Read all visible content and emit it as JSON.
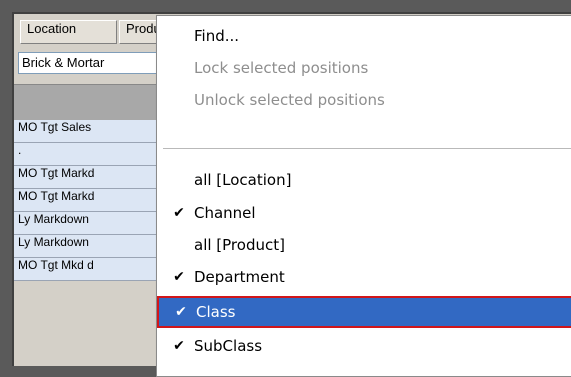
{
  "tabs": [
    {
      "label": "Location"
    },
    {
      "label": "Product"
    }
  ],
  "selector": {
    "value": "Brick & Mortar"
  },
  "rows": [
    {
      "label": "MO Tgt Sales"
    },
    {
      "label": "."
    },
    {
      "label": "MO Tgt Markd"
    },
    {
      "label": "MO Tgt Markd"
    },
    {
      "label": "Ly Markdown"
    },
    {
      "label": "Ly Markdown"
    },
    {
      "label": "MO Tgt Mkd d"
    }
  ],
  "menu": {
    "items": [
      {
        "label": "Find...",
        "disabled": false,
        "checked": false
      },
      {
        "label": "Lock selected positions",
        "disabled": true,
        "checked": false
      },
      {
        "label": "Unlock selected positions",
        "disabled": true,
        "checked": false
      },
      {
        "label": "all [Location]",
        "disabled": false,
        "checked": false
      },
      {
        "label": "Channel",
        "disabled": false,
        "checked": true
      },
      {
        "label": "all [Product]",
        "disabled": false,
        "checked": false
      },
      {
        "label": "Department",
        "disabled": false,
        "checked": true
      },
      {
        "label": "Class",
        "disabled": false,
        "checked": true,
        "selected": true
      },
      {
        "label": "SubClass",
        "disabled": false,
        "checked": true
      }
    ],
    "check_glyph": "✔",
    "colors": {
      "highlight": "#3269c3",
      "highlight_border": "#d1161a",
      "disabled_text": "#8e8e8e"
    }
  }
}
